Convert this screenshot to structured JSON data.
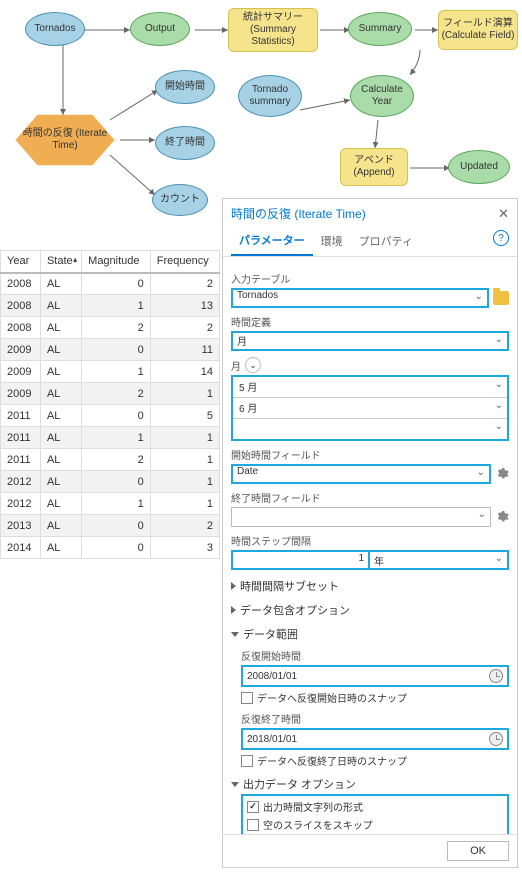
{
  "diagram": {
    "tornados": "Tornados",
    "output": "Output",
    "summary_stats": "統計サマリー (Summary Statistics)",
    "summary": "Summary",
    "calc_field": "フィールド演算 (Calculate Field)",
    "iterate_time": "時間の反復 (Iterate Time)",
    "start_time": "開始時間",
    "end_time": "終了時間",
    "count": "カウント",
    "tornado_summary": "Tornado summary",
    "calculate_year": "Calculate Year",
    "append": "アペンド (Append)",
    "updated": "Updated"
  },
  "table": {
    "columns": {
      "year": "Year",
      "state": "State",
      "magnitude": "Magnitude",
      "frequency": "Frequency"
    },
    "rows": [
      {
        "year": "2008",
        "state": "AL",
        "mag": "0",
        "freq": "2",
        "alt": false
      },
      {
        "year": "2008",
        "state": "AL",
        "mag": "1",
        "freq": "13",
        "alt": true
      },
      {
        "year": "2008",
        "state": "AL",
        "mag": "2",
        "freq": "2",
        "alt": false
      },
      {
        "year": "2009",
        "state": "AL",
        "mag": "0",
        "freq": "11",
        "alt": true
      },
      {
        "year": "2009",
        "state": "AL",
        "mag": "1",
        "freq": "14",
        "alt": false
      },
      {
        "year": "2009",
        "state": "AL",
        "mag": "2",
        "freq": "1",
        "alt": true
      },
      {
        "year": "2011",
        "state": "AL",
        "mag": "0",
        "freq": "5",
        "alt": false
      },
      {
        "year": "2011",
        "state": "AL",
        "mag": "1",
        "freq": "1",
        "alt": true
      },
      {
        "year": "2011",
        "state": "AL",
        "mag": "2",
        "freq": "1",
        "alt": false
      },
      {
        "year": "2012",
        "state": "AL",
        "mag": "0",
        "freq": "1",
        "alt": true
      },
      {
        "year": "2012",
        "state": "AL",
        "mag": "1",
        "freq": "1",
        "alt": false
      },
      {
        "year": "2013",
        "state": "AL",
        "mag": "0",
        "freq": "2",
        "alt": true
      },
      {
        "year": "2014",
        "state": "AL",
        "mag": "0",
        "freq": "3",
        "alt": false
      }
    ]
  },
  "panel": {
    "title": "時間の反復 (Iterate Time)",
    "tabs": {
      "params": "パラメーター",
      "env": "環境",
      "props": "プロパティ"
    },
    "help": "?",
    "close": "✕",
    "labels": {
      "input_table": "入力テーブル",
      "time_def": "時間定義",
      "month": "月",
      "start_field": "開始時間フィールド",
      "end_field": "終了時間フィールド",
      "step_interval": "時間ステップ間隔",
      "interval_subset": "時間間隔サブセット",
      "inclusion_opts": "データ包含オプション",
      "data_range": "データ範囲",
      "iter_start": "反復開始時間",
      "snap_start": "データへ反復開始日時のスナップ",
      "iter_end": "反復終了時間",
      "snap_end": "データへ反復終了日時のスナップ",
      "out_opts": "出力データ オプション",
      "out_fmt": "出力時間文字列の形式",
      "skip_empty": "空のスライスをスキップ"
    },
    "values": {
      "input_table": "Tornados",
      "time_def": "月",
      "month1": "5 月",
      "month2": "6 月",
      "start_field": "Date",
      "end_field": "",
      "step_num": "1",
      "step_unit": "年",
      "iter_start": "2008/01/01",
      "iter_end": "2018/01/01"
    },
    "ok": "OK"
  }
}
